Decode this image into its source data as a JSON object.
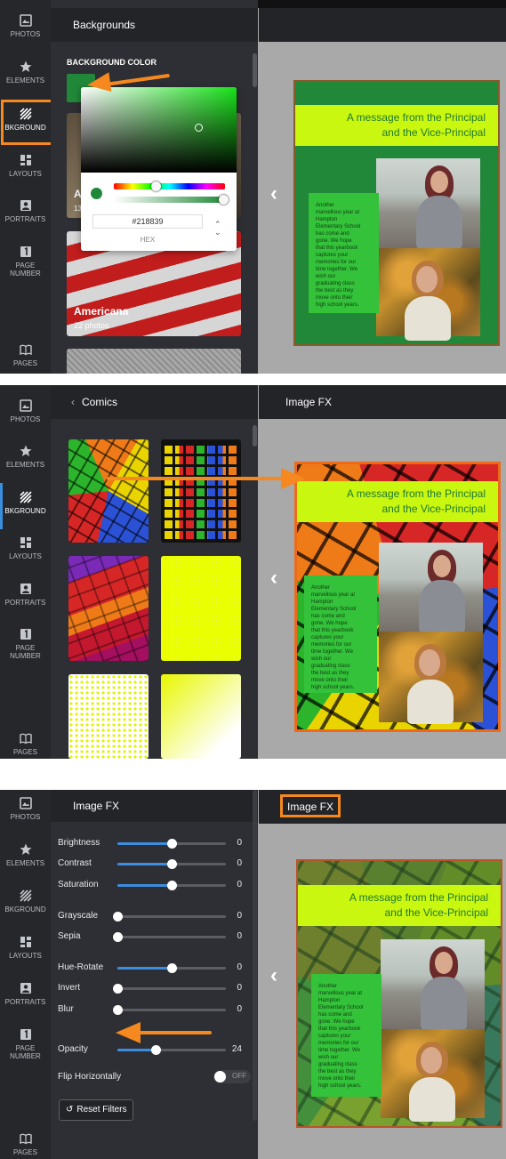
{
  "nav": {
    "photos": "PHOTOS",
    "elements": "ELEMENTS",
    "bkground": "BKGROUND",
    "layouts": "LAYOUTS",
    "portraits": "PORTRAITS",
    "page_number_1": "PAGE",
    "page_number_2": "NUMBER",
    "pages": "PAGES"
  },
  "colors": {
    "accent": "#f5891f",
    "bg_green": "#218839",
    "banner": "#c9f70f"
  },
  "panel1": {
    "sidebar_title": "Backgrounds",
    "section_label": "BACKGROUND COLOR",
    "hex_value": "#218839",
    "hex_label": "HEX",
    "card_a_letter": "A",
    "card_a_count": "13",
    "card_americana_title": "Americana",
    "card_americana_count": "22 photos"
  },
  "panel2": {
    "back_label": "Comics",
    "canvas_title": "Image FX"
  },
  "panel3": {
    "sidebar_title": "Image FX",
    "canvas_title": "Image FX",
    "sliders": [
      {
        "label": "Brightness",
        "value": "0"
      },
      {
        "label": "Contrast",
        "value": "0"
      },
      {
        "label": "Saturation",
        "value": "0"
      },
      {
        "label": "Grayscale",
        "value": "0"
      },
      {
        "label": "Sepia",
        "value": "0"
      },
      {
        "label": "Hue-Rotate",
        "value": "0"
      },
      {
        "label": "Invert",
        "value": "0"
      },
      {
        "label": "Blur",
        "value": "0"
      },
      {
        "label": "Opacity",
        "value": "24"
      }
    ],
    "flip_label": "Flip Horizontally",
    "flip_state": "OFF",
    "reset_label": "Reset Filters"
  },
  "page": {
    "banner_line1": "A message from the Principal",
    "banner_line2": "and the Vice-Principal",
    "message_1": "Another",
    "message_2": "marvellous year at",
    "message_3": "Hampton",
    "message_4": "Elementary School",
    "message_5": "has come and",
    "message_6": "gone. We hope",
    "message_7": "that this yearbook",
    "message_8": "captures your",
    "message_9": "memories for our",
    "message_10": "time together. We",
    "message_11": "wish our",
    "message_12": "graduating class",
    "message_13": "the best as they",
    "message_14": "move onto their",
    "message_15": "high school years."
  }
}
